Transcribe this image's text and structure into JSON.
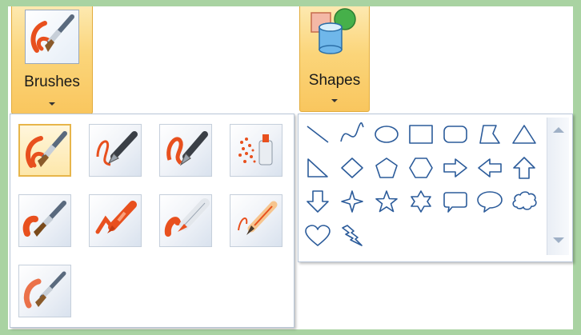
{
  "ribbon": {
    "brushes_label": "Brushes",
    "shapes_label": "Shapes"
  },
  "brushes_gallery": {
    "items": [
      {
        "name": "brush",
        "selected": true
      },
      {
        "name": "calligraphy-brush-1",
        "selected": false
      },
      {
        "name": "calligraphy-brush-2",
        "selected": false
      },
      {
        "name": "airbrush",
        "selected": false
      },
      {
        "name": "oil-brush",
        "selected": false
      },
      {
        "name": "crayon",
        "selected": false
      },
      {
        "name": "marker",
        "selected": false
      },
      {
        "name": "natural-pencil",
        "selected": false
      },
      {
        "name": "watercolor-brush",
        "selected": false
      }
    ]
  },
  "shapes_gallery": {
    "items": [
      "line",
      "curve",
      "oval",
      "rectangle",
      "rounded-rectangle",
      "polygon",
      "triangle",
      "right-triangle",
      "diamond",
      "pentagon",
      "hexagon",
      "right-arrow",
      "left-arrow",
      "up-arrow",
      "down-arrow",
      "four-point-star",
      "five-point-star",
      "six-point-star",
      "rounded-rectangular-callout",
      "oval-callout",
      "cloud-callout",
      "heart",
      "lightning"
    ]
  },
  "colors": {
    "accent_orange": "#e8501e",
    "shape_outline": "#2b5b9a",
    "selected_gold": "#e7b54a"
  }
}
